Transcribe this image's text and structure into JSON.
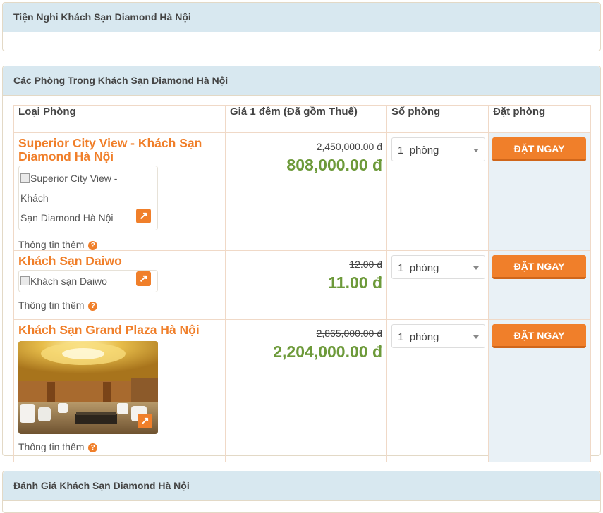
{
  "sections": {
    "amenities_title": "Tiện Nghi Khách Sạn Diamond Hà Nội",
    "rooms_title": "Các Phòng Trong Khách Sạn Diamond Hà Nội",
    "reviews_title": "Đánh Giá Khách Sạn Diamond Hà Nội"
  },
  "table": {
    "headers": [
      "Loại Phòng",
      "Giá 1 đêm (Đã gồm Thuế)",
      "Số phòng",
      "Đặt phòng"
    ],
    "rows": [
      {
        "name_line1": "Superior City View - Khách Sạn",
        "name_line2": "Diamond Hà Nội",
        "img_alt_line1": "Superior City View - Khách",
        "img_alt_line2": "Sạn Diamond Hà Nội",
        "more": "Thông tin thêm",
        "old_price": "2,450,000.00 đ",
        "new_price": "808,000.00",
        "qty": "1",
        "qty_unit": "phòng",
        "book": "ĐẶT NGAY"
      },
      {
        "name_line1": "Khách Sạn Daiwo",
        "img_alt_line1": "Khách sạn Daiwo",
        "more": "Thông tin thêm",
        "old_price": "12.00 đ",
        "new_price": "11.00",
        "qty": "1",
        "qty_unit": "phòng",
        "book": "ĐẶT NGAY"
      },
      {
        "name_line1": "Khách Sạn Grand Plaza Hà Nội",
        "more": "Thông tin thêm",
        "old_price": "2,865,000.00 đ",
        "new_price": "2,204,000.00",
        "qty": "1",
        "qty_unit": "phòng",
        "book": "ĐẶT NGAY"
      }
    ],
    "currency": "đ"
  },
  "colors": {
    "accent": "#f07f2a",
    "price_green": "#6d9a3a",
    "panel_header": "#d8e8f0"
  }
}
